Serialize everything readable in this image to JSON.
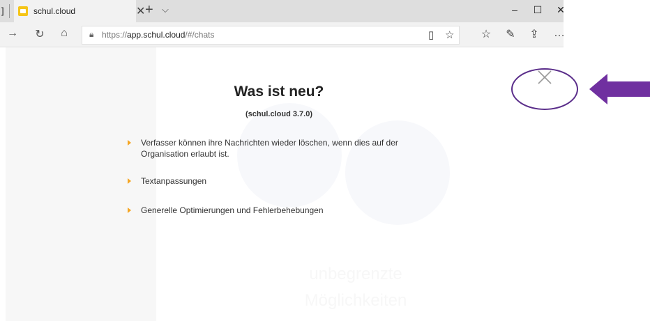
{
  "browser": {
    "tab": {
      "title": "schul.cloud",
      "edge_label": "]"
    },
    "address": {
      "prefix": "https://",
      "domain": "app.schul.cloud",
      "path": "/#/chats"
    }
  },
  "dialog": {
    "title": "Was ist neu?",
    "version": "(schul.cloud 3.7.0)",
    "items": [
      "Verfasser können ihre Nachrichten wieder löschen, wenn dies auf der Organisation erlaubt ist.",
      "Textanpassungen",
      "Generelle Optimierungen und Fehlerbehebungen"
    ]
  },
  "background": {
    "tagline_1": "unbegrenzte",
    "tagline_2": "Möglichkeiten"
  },
  "colors": {
    "annotation_purple": "#7030a0",
    "bullet_orange": "#f5a623",
    "favicon_yellow": "#f5c518"
  }
}
